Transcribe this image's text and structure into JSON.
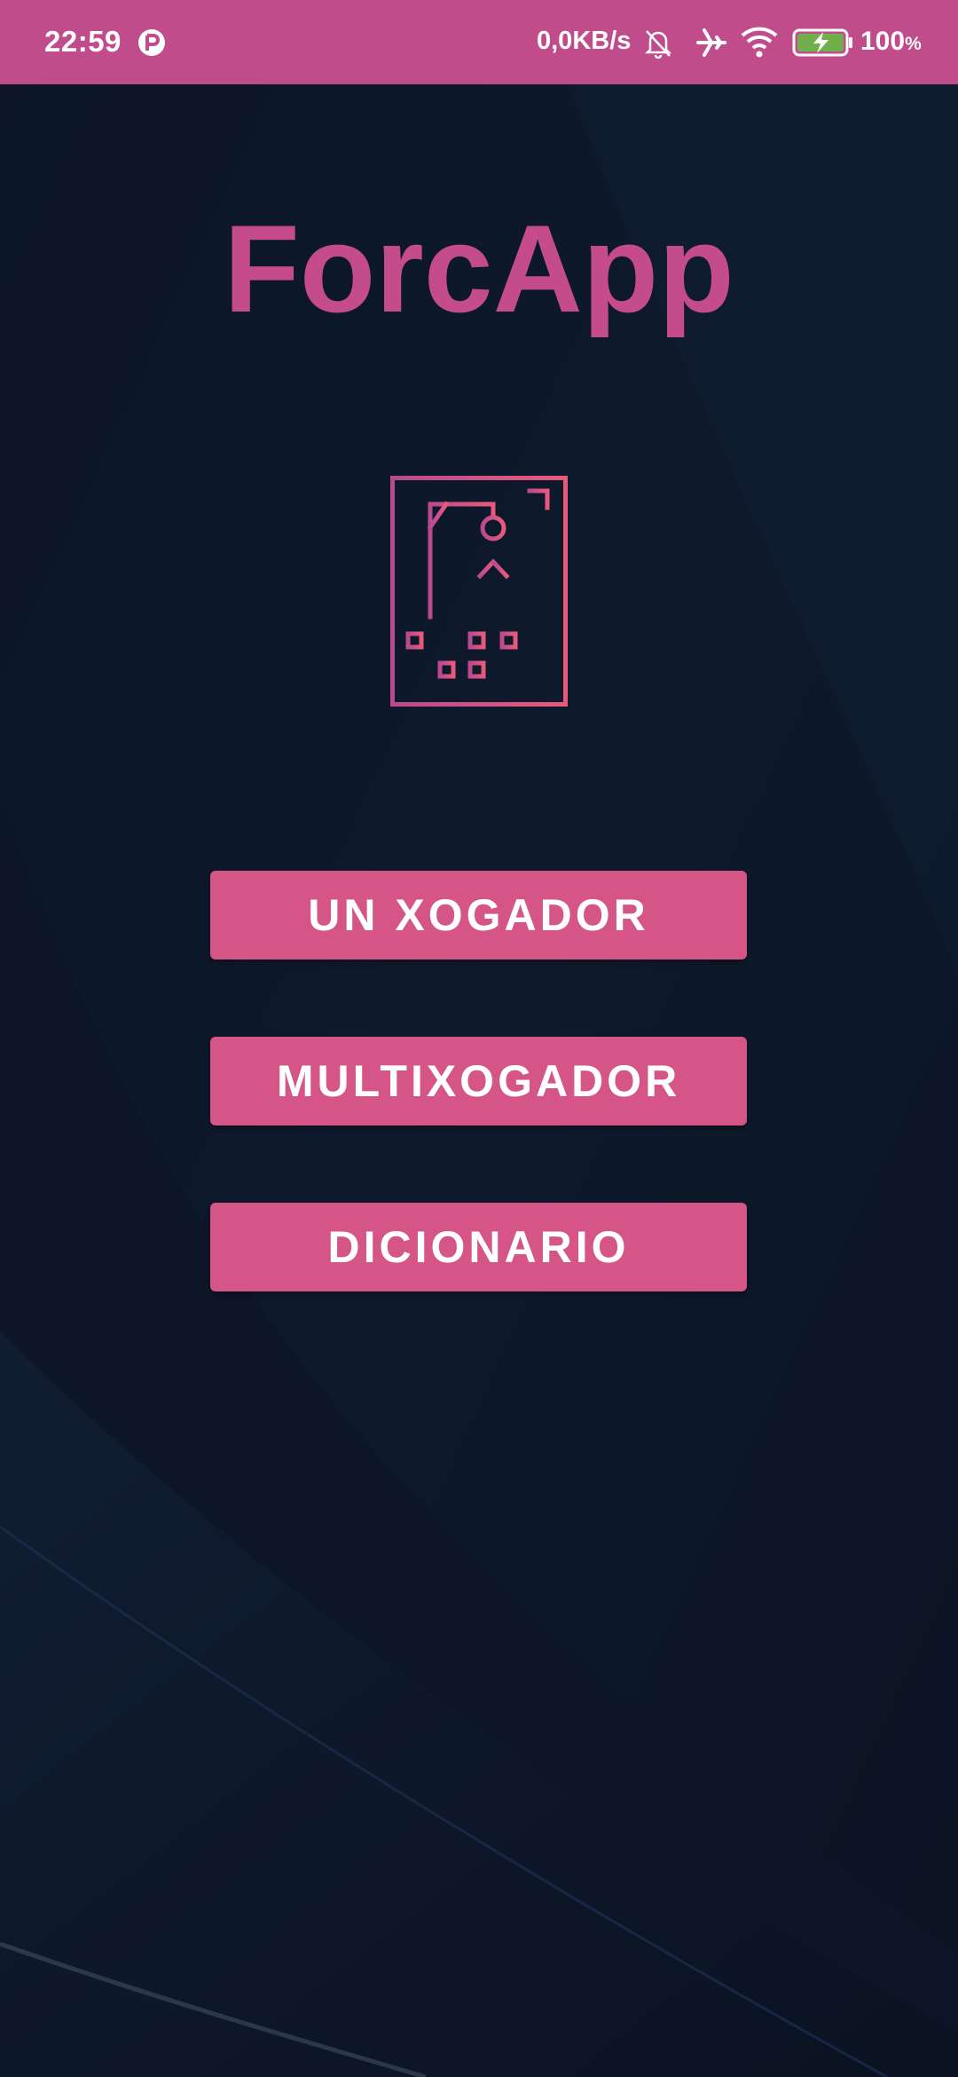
{
  "status_bar": {
    "time": "22:59",
    "network_speed": "0,0KB/s",
    "battery_level": "100",
    "battery_unit": "%",
    "icons": [
      "notification-app-icon",
      "bell-muted-icon",
      "airplane-mode-icon",
      "wifi-icon",
      "battery-charging-icon"
    ],
    "background_color": "#c04c8c"
  },
  "app": {
    "title": "ForcApp",
    "logo_icon": "hangman-icon",
    "accent_color": "#d55586"
  },
  "menu": {
    "single_player": "UN XOGADOR",
    "multiplayer": "MULTIXOGADOR",
    "dictionary": "DICIONARIO"
  }
}
